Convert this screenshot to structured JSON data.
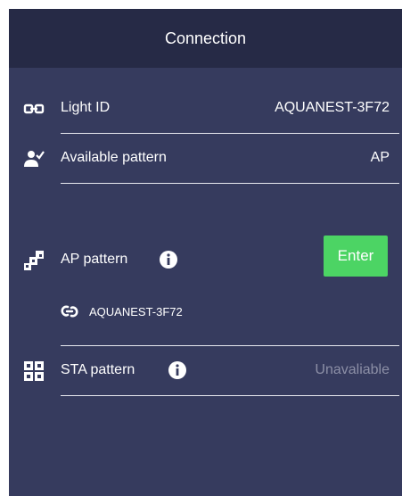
{
  "header": {
    "title": "Connection"
  },
  "rows": {
    "light_id": {
      "label": "Light ID",
      "value": "AQUANEST-3F72",
      "icon": "link-chain-icon"
    },
    "available": {
      "label": "Available pattern",
      "value": "AP",
      "icon": "user-check-icon"
    },
    "ap": {
      "label": "AP pattern",
      "button": "Enter",
      "ssid": "AQUANEST-3F72",
      "icon": "network-steps-icon"
    },
    "sta": {
      "label": "STA pattern",
      "value": "Unavaliable",
      "icon": "grid-scan-icon"
    }
  },
  "colors": {
    "background": "#363b5e",
    "header": "#262a46",
    "accent_green": "#4cd464",
    "muted_text": "#8c8fa6"
  }
}
